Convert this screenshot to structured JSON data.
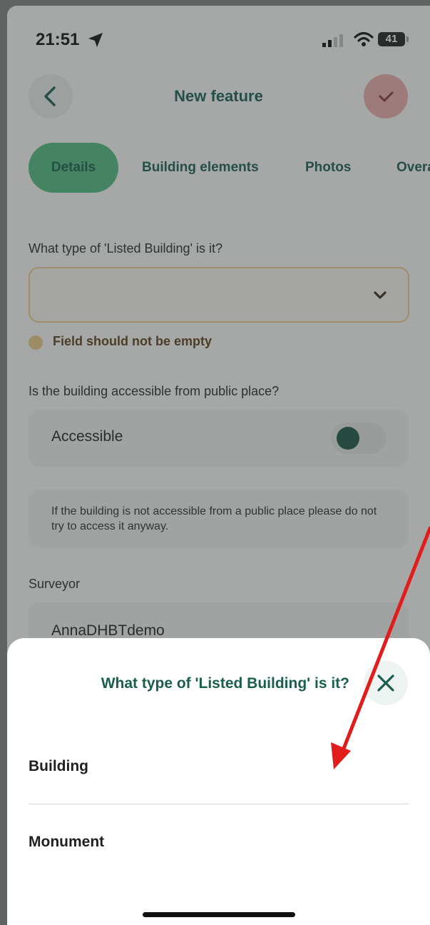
{
  "status_bar": {
    "time": "21:51",
    "battery": "41"
  },
  "header": {
    "title": "New feature"
  },
  "tabs": [
    {
      "label": "Details"
    },
    {
      "label": "Building elements"
    },
    {
      "label": "Photos"
    },
    {
      "label": "Overa"
    }
  ],
  "form": {
    "type_question": "What type of 'Listed Building' is it?",
    "error": "Field should not be empty",
    "access_question": "Is the building accessible from public place?",
    "accessible_label": "Accessible",
    "info": "If the building is not accessible from a public place please do not try to access it anyway.",
    "surveyor_label": "Surveyor",
    "surveyor_value": "AnnaDHBTdemo"
  },
  "sheet": {
    "title": "What type of 'Listed Building' is it?",
    "options": [
      {
        "label": "Building"
      },
      {
        "label": "Monument"
      }
    ]
  },
  "colors": {
    "accent": "#1a5e4c",
    "active_tab": "#4fb882",
    "confirm": "#e9aaab",
    "warning": "#e7c98e",
    "annotation": "#e21b1b"
  }
}
